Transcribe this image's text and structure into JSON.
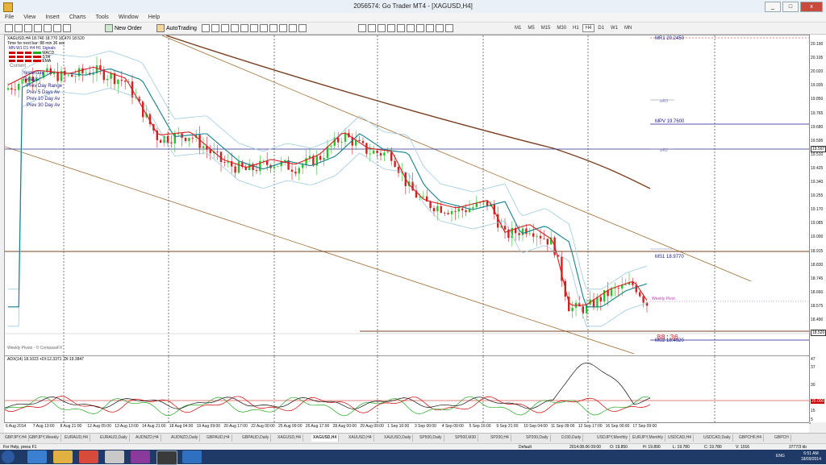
{
  "window": {
    "title": "2056574: Go Trader MT4 - [XAGUSD,H4]",
    "buttons": [
      "_",
      "□",
      "x"
    ]
  },
  "menu": [
    "File",
    "View",
    "Insert",
    "Charts",
    "Tools",
    "Window",
    "Help"
  ],
  "toolbar": {
    "new_order": "New Order",
    "autotrading": "AutoTrading"
  },
  "timeframes": [
    "M1",
    "M5",
    "M15",
    "M30",
    "H1",
    "H4",
    "D1",
    "W1",
    "MN"
  ],
  "active_timeframe": "H4",
  "chart": {
    "header": "XAGUSD,H4  18.740 18.770 18.470 18.520",
    "timer": "Time for next bar: 88 min 36 sec",
    "ind_rows": [
      "MN  W1  D1  H4  H1  Signals",
      "MACD",
      "STR",
      "EMA"
    ],
    "legend_items": [
      "Current",
      "Yesterday",
      "Today's",
      "Prev Day Range",
      "Prev 5 Days Av",
      "Prev 10 Day Av",
      "Prev 30 Day Av"
    ],
    "watermark": "Weekly Pivots - © CompassFX",
    "countdown": "88:36",
    "weekly_pivot": "Weekly Pivot",
    "pivots": [
      {
        "name": "MR1",
        "value": "20.2450"
      },
      {
        "name": "wR3",
        "value": ""
      },
      {
        "name": "MPV",
        "value": "19.7600"
      },
      {
        "name": "wR2",
        "value": ""
      },
      {
        "name": "MS1",
        "value": "18.9770"
      },
      {
        "name": "MS2",
        "value": "18.4920"
      }
    ]
  },
  "price_axis": [
    "20.190",
    "20.105",
    "20.020",
    "19.935",
    "19.850",
    "19.765",
    "19.680",
    "19.595",
    "19.510",
    "19.425",
    "19.340",
    "19.255",
    "19.170",
    "19.085",
    "19.000",
    "18.915",
    "18.830",
    "18.745",
    "18.660",
    "18.575",
    "18.490",
    "18.405"
  ],
  "price_markers": {
    "hline": "19.597",
    "bid": "18.520"
  },
  "adx": {
    "label": "ADX(14) 18.1023 +DI:12.3371 -DI:19.3847",
    "levels": [
      "47",
      "37",
      "30",
      "20.000",
      "15",
      "5"
    ]
  },
  "time_axis": [
    "6 Aug 2014",
    "7 Aug 13:00",
    "8 Aug 21:00",
    "12 Aug 05:00",
    "13 Aug 13:00",
    "14 Aug 21:00",
    "18 Aug 04:00",
    "19 Aug 09:00",
    "20 Aug 17:00",
    "22 Aug 00:00",
    "25 Aug 09:00",
    "26 Aug 17:00",
    "28 Aug 00:00",
    "29 Aug 09:00",
    "1 Sep 16:00",
    "3 Sep 00:00",
    "4 Sep 09:00",
    "5 Sep 16:00",
    "9 Sep 21:00",
    "10 Sep 04:00",
    "11 Sep 09:00",
    "12 Sep 17:00",
    "16 Sep 00:00",
    "17 Sep 09:00"
  ],
  "tabs": [
    "GBPJPY,H4",
    "GBPJPY,Weekly",
    "EURAUD,H4",
    "EURAUD,Daily",
    "AUDNZD,H4",
    "AUDNZD,Daily",
    "GBPAUD,H4",
    "GBPAUD,Daily",
    "XAGUSD,H4",
    "XAGUSD,H4",
    "XAUUSD,H4",
    "XAUUSD,Daily",
    "SP500,Daily",
    "SP500,M30",
    "SP200,H4",
    "SP200,Daily",
    "DJ30,Daily",
    "USDJPY,Monthly",
    "EURJPY,Monthly",
    "USDCAD,H4",
    "USDCAD,Daily",
    "GBPCHF,H4",
    "GBPCH"
  ],
  "active_tab_index": 9,
  "status": {
    "help": "For Help, press F1",
    "profile": "Default",
    "datetime": "2014.08.06 09:00",
    "o": "O: 19.850",
    "h": "H: 19.890",
    "l": "L: 19.780",
    "c": "C: 19.780",
    "v": "V: 1016",
    "traffic": "3777/3 kb"
  },
  "taskbar": {
    "lang": "ENG",
    "time": "6:51 AM",
    "date": "18/09/2014"
  },
  "colors": {
    "bull": "#2bbf2b",
    "bear": "#d42020",
    "ema_fast": "#d42020",
    "ema_slow": "#12808a",
    "bands": "#9ccae0",
    "channel": "#a06a30",
    "ma200": "#7a4020",
    "pivot_navy": "#1a1a8a"
  }
}
